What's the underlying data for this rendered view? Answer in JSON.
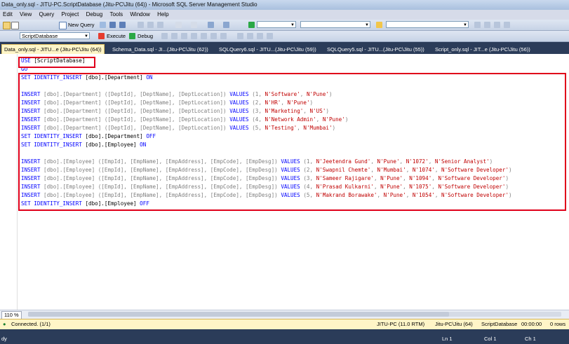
{
  "window": {
    "title": "Data_only.sql - JITU-PC.ScriptDatabase (Jitu-PC\\Jitu (64)) - Microsoft SQL Server Management Studio"
  },
  "menu": [
    "Edit",
    "View",
    "Query",
    "Project",
    "Debug",
    "Tools",
    "Window",
    "Help"
  ],
  "toolbar": {
    "new_query": "New Query",
    "database": "ScriptDatabase",
    "execute": "Execute",
    "debug": "Debug"
  },
  "tabs": [
    {
      "label": "Data_only.sql - JITU...e (Jitu-PC\\Jitu (64))",
      "active": true
    },
    {
      "label": "Schema_Data.sql - JI...(Jitu-PC\\Jitu (62))"
    },
    {
      "label": "SQLQuery6.sql - JITU...(Jitu-PC\\Jitu (59))"
    },
    {
      "label": "SQLQuery5.sql - JITU...(Jitu-PC\\Jitu (55))"
    },
    {
      "label": "Script_only.sql - JIT...e (Jitu-PC\\Jitu (56))"
    }
  ],
  "code": {
    "l1": {
      "kw": "USE",
      "txt": " [ScriptDatabase]"
    },
    "l2": {
      "kw": "GO"
    },
    "l3": {
      "kw": "SET IDENTITY_INSERT",
      "obj": " [dbo].[Department] ",
      "kw2": "ON"
    },
    "dept_prefix": "INSERT",
    "dept_cols": " [dbo].[Department] ([DeptId], [DeptName], [DeptLocation]) ",
    "values_kw": "VALUES",
    "dept_rows": [
      {
        "id": "(1, ",
        "name": "N'Software'",
        "loc": "N'Pune'"
      },
      {
        "id": "(2, ",
        "name": "N'HR'",
        "loc": "N'Pune'"
      },
      {
        "id": "(3, ",
        "name": "N'Marketing'",
        "loc": "N'US'"
      },
      {
        "id": "(4, ",
        "name": "N'Network Admin'",
        "loc": "N'Pune'"
      },
      {
        "id": "(5, ",
        "name": "N'Testing'",
        "loc": "N'Mumbai'"
      }
    ],
    "set_dept_off": {
      "kw": "SET IDENTITY_INSERT",
      "obj": " [dbo].[Department] ",
      "kw2": "OFF"
    },
    "set_emp_on": {
      "kw": "SET IDENTITY_INSERT",
      "obj": " [dbo].[Employee] ",
      "kw2": "ON"
    },
    "emp_cols": " [dbo].[Employee] ([EmpId], [EmpName], [EmpAddress], [EmpCode], [EmpDesg]) ",
    "emp_rows": [
      {
        "id": "(1, ",
        "name": "N'Jeetendra Gund'",
        "addr": "N'Pune'",
        "code": "N'1072'",
        "desg": "N'Senior Analyst'"
      },
      {
        "id": "(2, ",
        "name": "N'Swapnil Chemte'",
        "addr": "N'Mumbai'",
        "code": "N'1074'",
        "desg": "N'Software Developer'"
      },
      {
        "id": "(3, ",
        "name": "N'Sameer Rajigare'",
        "addr": "N'Pune'",
        "code": "N'1094'",
        "desg": "N'Software Developer'"
      },
      {
        "id": "(4, ",
        "name": "N'Prasad Kulkarni'",
        "addr": "N'Pune'",
        "code": "N'1075'",
        "desg": "N'Software Developer'"
      },
      {
        "id": "(5, ",
        "name": "N'Makrand Borawake'",
        "addr": "N'Pune'",
        "code": "N'1054'",
        "desg": "N'Software Developer'"
      }
    ],
    "set_emp_off": {
      "kw": "SET IDENTITY_INSERT",
      "obj": " [dbo].[Employee] ",
      "kw2": "OFF"
    }
  },
  "zoom": "110 %",
  "query_status": {
    "connected": "Connected. (1/1)",
    "server": "JITU-PC (11.0 RTM)",
    "user": "Jitu-PC\\Jitu (64)",
    "db": "ScriptDatabase",
    "time": "00:00:00",
    "rows": "0 rows"
  },
  "status": {
    "ready": "dy",
    "ln": "Ln 1",
    "col": "Col 1",
    "ch": "Ch 1"
  },
  "colors": {
    "keyword": "#0000ff",
    "string": "#c00000",
    "highlight": "#e0001a"
  }
}
